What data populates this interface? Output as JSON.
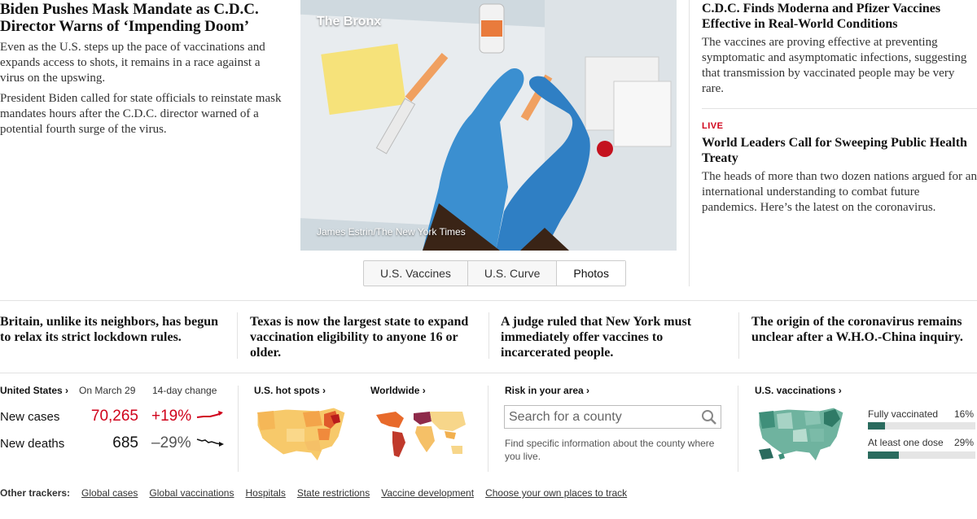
{
  "lead": {
    "headline": "Biden Pushes Mask Mandate as C.D.C. Director Warns of ‘Impending Doom’",
    "summary1": "Even as the U.S. steps up the pace of vaccinations and expands access to shots, it remains in a race against a virus on the upswing.",
    "summary2": "President Biden called for state officials to reinstate mask mandates hours after the C.D.C. director warned of a potential fourth surge of the virus."
  },
  "photo": {
    "location": "The Bronx",
    "credit": "James Estrin/The New York Times"
  },
  "tabs": [
    "U.S. Vaccines",
    "U.S. Curve",
    "Photos"
  ],
  "right": {
    "story1_headline": "C.D.C. Finds Moderna and Pfizer Vaccines Effective in Real-World Conditions",
    "story1_summary": "The vaccines are proving effective at preventing symptomatic and asymptomatic infections, suggesting that transmission by vaccinated people may be very rare.",
    "live_label": "LIVE",
    "story2_headline": "World Leaders Call for Sweeping Public Health Treaty",
    "story2_summary": "The heads of more than two dozen nations argued for an international understanding to combat future pandemics. Here’s the latest on the coronavirus."
  },
  "mid_headlines": [
    "Britain, unlike its neighbors, has begun to relax its strict lockdown rules.",
    "Texas is now the largest state to expand vaccination eligibility to anyone 16 or older.",
    "A judge ruled that New York must immediately offer vaccines to incarcerated people.",
    "The origin of the coronavirus remains unclear after a W.H.O.-China inquiry."
  ],
  "us_tracker": {
    "title": "United States ›",
    "date": "On March 29",
    "change_label": "14-day change",
    "cases_label": "New cases",
    "cases_value": "70,265",
    "cases_change": "+19%",
    "deaths_label": "New deaths",
    "deaths_value": "685",
    "deaths_change": "–29%"
  },
  "hotspots_title": "U.S. hot spots ›",
  "worldwide_title": "Worldwide ›",
  "risk": {
    "title": "Risk in your area ›",
    "placeholder": "Search for a county",
    "hint": "Find specific information about the county where you live."
  },
  "vaccinations": {
    "title": "U.S. vaccinations ›",
    "fully_label": "Fully vaccinated",
    "fully_pct": "16%",
    "fully_value": 16,
    "one_dose_label": "At least one dose",
    "one_dose_pct": "29%",
    "one_dose_value": 29
  },
  "footer": {
    "label": "Other trackers:",
    "links": [
      "Global cases",
      "Global vaccinations",
      "Hospitals",
      "State restrictions",
      "Vaccine development",
      "Choose your own places to track"
    ]
  },
  "colors": {
    "red": "#d0021b",
    "teal": "#2a6b5e"
  }
}
